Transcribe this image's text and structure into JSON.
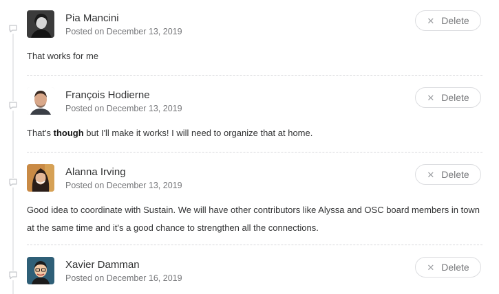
{
  "delete_label": "Delete",
  "comments": [
    {
      "author": "Pia Mancini",
      "date": "Posted on December 13, 2019",
      "body_parts": [
        "That works for me"
      ]
    },
    {
      "author": "François Hodierne",
      "date": "Posted on December 13, 2019",
      "body_parts": [
        "That's ",
        "though",
        " but I'll make it works! I will need to organize that at home."
      ]
    },
    {
      "author": "Alanna Irving",
      "date": "Posted on December 13, 2019",
      "body_parts": [
        "Good idea to coordinate with Sustain. We will have other contributors like Alyssa and OSC board members in town at the same time and it's a good chance to strengthen all the connections."
      ]
    },
    {
      "author": "Xavier Damman",
      "date": "Posted on December 16, 2019",
      "body_parts": []
    }
  ]
}
